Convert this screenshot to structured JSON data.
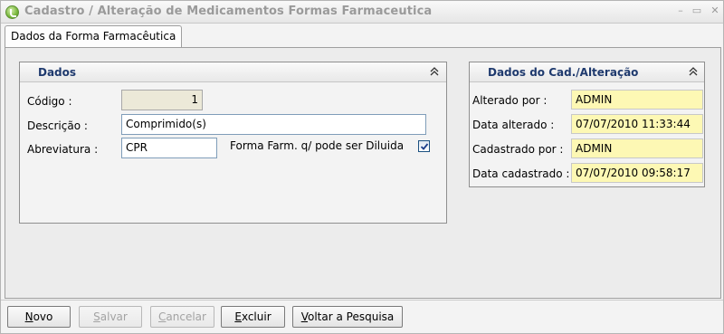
{
  "window": {
    "title": "Cadastro / Alteração de Medicamentos Formas Farmaceutica",
    "controls": {
      "minimize": "–",
      "maximize": "▭",
      "close": "✕"
    }
  },
  "tabs": [
    {
      "label": "Dados da Forma Farmacêutica",
      "active": true
    }
  ],
  "dados": {
    "title": "Dados",
    "codigo_label": "Código :",
    "codigo_value": "1",
    "descricao_label": "Descrição :",
    "descricao_value": "Comprimido(s)",
    "abreviatura_label": "Abreviatura :",
    "abreviatura_value": "CPR",
    "diluida_label": "Forma Farm. q/ pode ser Diluida",
    "diluida_checked": true
  },
  "audit": {
    "title": "Dados do Cad./Alteração",
    "alterado_por_label": "Alterado por :",
    "alterado_por_value": "ADMIN",
    "data_alterado_label": "Data alterado :",
    "data_alterado_value": "07/07/2010 11:33:44",
    "cadastrado_por_label": "Cadastrado por :",
    "cadastrado_por_value": "ADMIN",
    "data_cadastrado_label": "Data cadastrado :",
    "data_cadastrado_value": "07/07/2010 09:58:17"
  },
  "buttons": {
    "novo": {
      "label": "Novo",
      "enabled": true
    },
    "salvar": {
      "label": "Salvar",
      "enabled": false
    },
    "cancelar": {
      "label": "Cancelar",
      "enabled": false
    },
    "excluir": {
      "label": "Excluir",
      "enabled": true
    },
    "voltar": {
      "label": "Voltar a Pesquisa",
      "enabled": true
    }
  },
  "colors": {
    "group_title": "#1f3a6e",
    "readonly_field": "#fdf8b4",
    "disabled_text": "#a3a3a3"
  }
}
